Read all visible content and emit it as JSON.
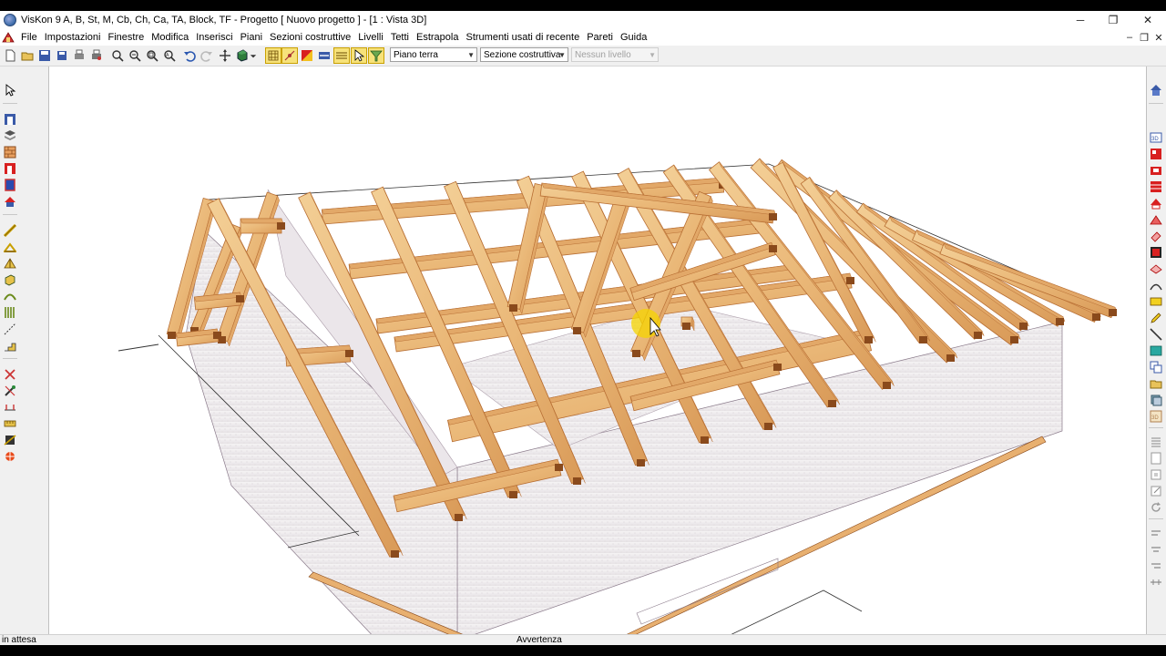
{
  "window": {
    "title": "VisKon 9 A, B, St, M, Cb, Ch, Ca, TA, Block, TF - Progetto [ Nuovo progetto ] - [1 : Vista 3D]",
    "controls": {
      "minimize": "─",
      "restore": "❐",
      "close": "✕"
    },
    "mdi_controls": {
      "minimize": "‒",
      "restore": "❐",
      "close": "✕"
    }
  },
  "menu": {
    "items": [
      "File",
      "Impostazioni",
      "Finestre",
      "Modifica",
      "Inserisci",
      "Piani",
      "Sezioni costruttive",
      "Livelli",
      "Tetti",
      "Estrapola",
      "Strumenti usati di recente",
      "Pareti",
      "Guida"
    ]
  },
  "toolbar": {
    "floor_select": {
      "value": "Piano terra"
    },
    "section_select": {
      "value": "Sezione costruttiva"
    },
    "level_select": {
      "value": "Nessun livello",
      "disabled": true
    }
  },
  "statusbar": {
    "left": "in attesa",
    "center": "Avvertenza"
  },
  "colors": {
    "timber_light": "#f1c98c",
    "timber_mid": "#e2a868",
    "timber_dark": "#b86f34",
    "timber_end": "#8a4a1c",
    "wall": "#f3f1f2",
    "wall_shadow": "#dcd7db",
    "highlight": "#f5d400"
  }
}
